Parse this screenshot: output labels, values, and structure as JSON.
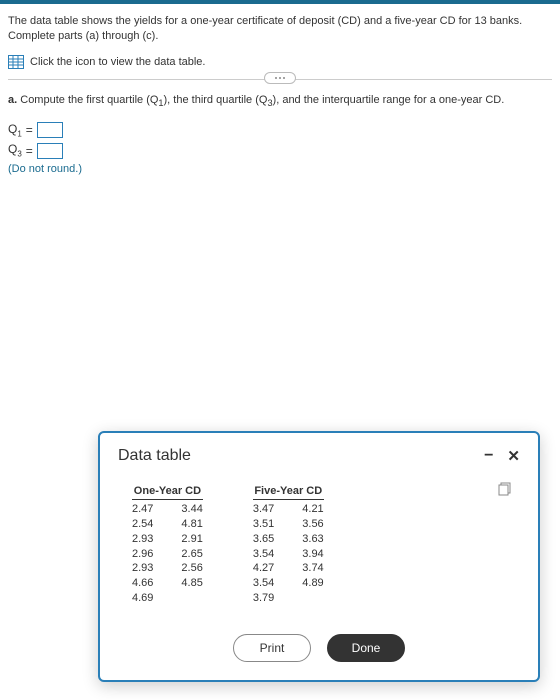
{
  "problem_text": "The data table shows the yields for a one-year certificate of deposit (CD) and a five-year CD for 13 banks. Complete parts (a) through (c).",
  "icon_instruction": "Click the icon to view the data table.",
  "part_a": {
    "label": "a.",
    "text": "Compute the first quartile (Q",
    "sub1": "1",
    "text2": "), the third quartile (Q",
    "sub3": "3",
    "text3": "), and the interquartile range for a one-year CD."
  },
  "answers": {
    "q1_label_pre": "Q",
    "q1_sub": "1",
    "eq": "=",
    "q3_label_pre": "Q",
    "q3_sub": "3",
    "note": "(Do not round.)"
  },
  "modal": {
    "title": "Data table",
    "print": "Print",
    "done": "Done",
    "one_year_head": "One-Year CD",
    "five_year_head": "Five-Year CD",
    "one_year_col1": [
      "2.47",
      "2.54",
      "2.93",
      "2.96",
      "2.93",
      "4.66",
      "4.69"
    ],
    "one_year_col2": [
      "3.44",
      "4.81",
      "2.91",
      "2.65",
      "2.56",
      "4.85"
    ],
    "five_year_col1": [
      "3.47",
      "3.51",
      "3.65",
      "3.54",
      "4.27",
      "3.54",
      "3.79"
    ],
    "five_year_col2": [
      "4.21",
      "3.56",
      "3.63",
      "3.94",
      "3.74",
      "4.89"
    ]
  }
}
